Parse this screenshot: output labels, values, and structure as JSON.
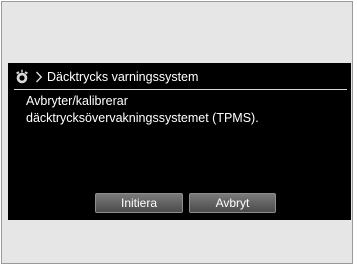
{
  "dialog": {
    "title": "Däcktrycks varningssystem",
    "icon": "tpms-tire-icon",
    "message_line1": "Avbryter/kalibrerar",
    "message_line2": "däcktrycksövervakningssystemet (TPMS).",
    "buttons": {
      "start_label": "Initiera",
      "cancel_label": "Avbryt"
    }
  },
  "colors": {
    "screen_background": "#000000",
    "frame_background": "#e6e6e6",
    "button_gray": "#5f5f5f",
    "text": "#ffffff"
  }
}
